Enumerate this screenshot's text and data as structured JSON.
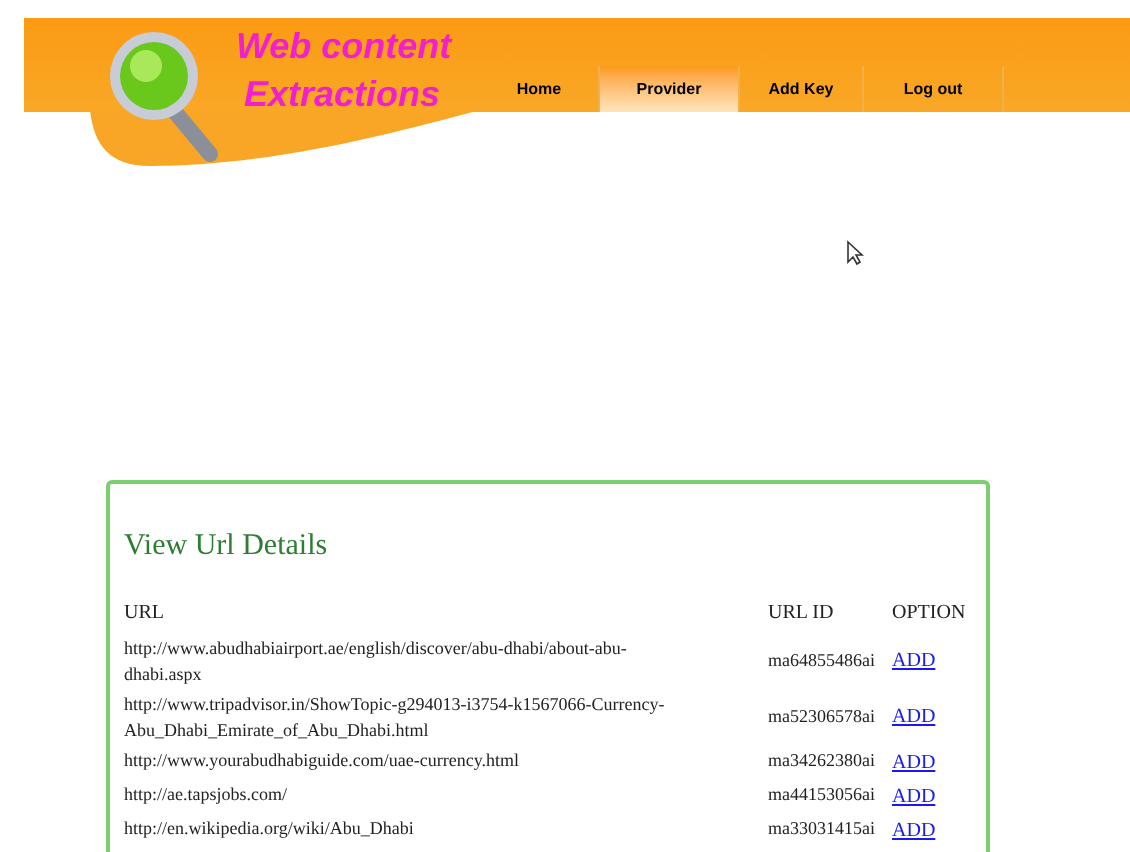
{
  "header": {
    "title_line_1": "Web content",
    "title_line_2": "Extractions"
  },
  "nav": [
    {
      "label": "Home",
      "selected": false
    },
    {
      "label": "Provider",
      "selected": true
    },
    {
      "label": "Add Key",
      "selected": false
    },
    {
      "label": "Log out",
      "selected": false
    }
  ],
  "panel": {
    "title": "View Url Details",
    "table": {
      "columns": [
        "URL",
        "URL ID",
        "OPTION"
      ],
      "rows": [
        {
          "url": "http://www.abudhabiairport.ae/english/discover/abu-dhabi/about-abu-dhabi.aspx",
          "url_id": "ma64855486ai",
          "option": "ADD"
        },
        {
          "url": "http://www.tripadvisor.in/ShowTopic-g294013-i3754-k1567066-Currency-Abu_Dhabi_Emirate_of_Abu_Dhabi.html",
          "url_id": "ma52306578ai",
          "option": "ADD"
        },
        {
          "url": "http://www.yourabudhabiguide.com/uae-currency.html",
          "url_id": "ma34262380ai",
          "option": "ADD"
        },
        {
          "url": "http://ae.tapsjobs.com/",
          "url_id": "ma44153056ai",
          "option": "ADD"
        },
        {
          "url": "http://en.wikipedia.org/wiki/Abu_Dhabi",
          "url_id": "ma33031415ai",
          "option": "ADD"
        }
      ]
    }
  }
}
